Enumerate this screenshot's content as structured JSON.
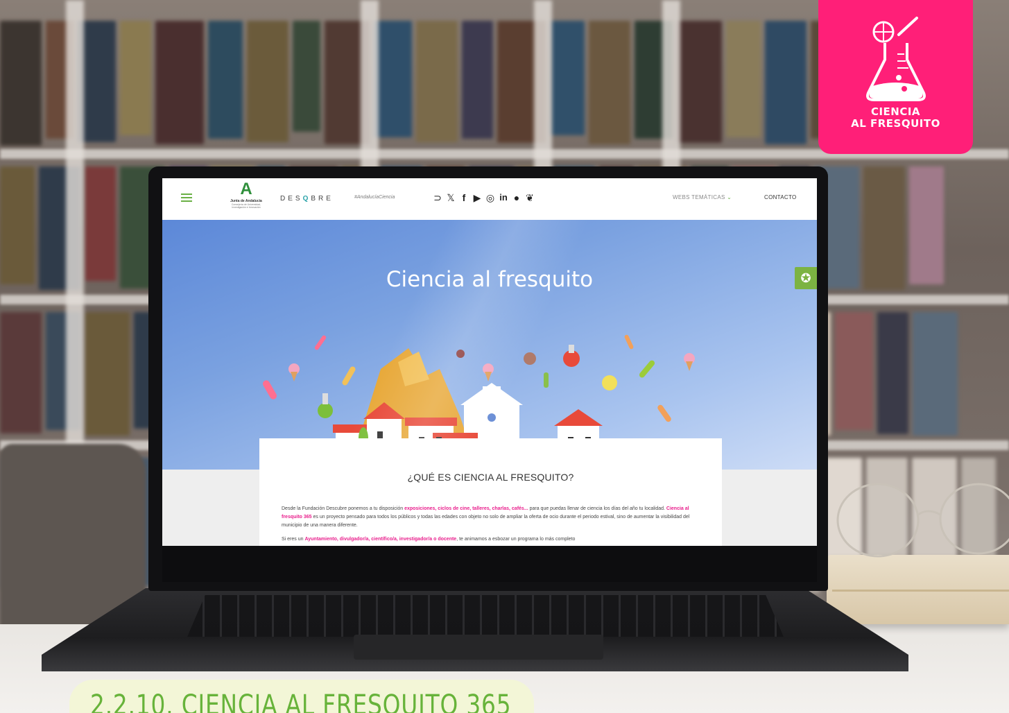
{
  "photo": {
    "description": ""
  },
  "badge": {
    "line1": "CIENCIA",
    "line2": "AL FRESQUITO",
    "color": "#ff1f78"
  },
  "website": {
    "nav": {
      "menu_icon": "hamburger-icon",
      "logo_main": "Junta de Andalucía",
      "logo_sub_1": "Consejería de Universidad,",
      "logo_sub_2": "Investigación e Innovación",
      "brand": "DESQBRE",
      "hashtag": "#AndalucíaCiencia",
      "social_icons": [
        "rss-icon",
        "x-icon",
        "facebook-icon",
        "youtube-icon",
        "instagram-icon",
        "linkedin-icon",
        "spotify-icon",
        "bluesky-icon"
      ],
      "webs_tematicas": "WEBS TEMÁTICAS",
      "contacto": "CONTACTO"
    },
    "hero": {
      "title": "Ciencia al fresquito",
      "accessibility_icon": "accessibility-icon"
    },
    "card": {
      "title": "¿QUÉ ES CIENCIA AL FRESQUITO?",
      "p1_a": "Desde la Fundación Descubre ponemos a tu disposición ",
      "p1_b": "exposiciones, ciclos de cine, talleres, charlas, cafés...",
      "p1_c": " para que puedas llenar de ciencia los días del año tu localidad. ",
      "p1_d": "Ciencia al fresquito 365",
      "p1_e": " es un proyecto pensado para todos los públicos y todas las edades con objeto no solo de ampliar la oferta de ocio durante el periodo estival, sino de aumentar la visibilidad del municipio de una manera diferente.",
      "p2_a": "Si eres un ",
      "p2_b": "Ayuntamiento, divulgador/a, científico/a, investigador/a o docente",
      "p2_c": ", te animamos a esbozar un programa lo más completo"
    },
    "colors": {
      "accent_green": "#6ab045",
      "highlight_pink": "#e91e8c"
    }
  },
  "section_heading": "2.2.10. CIENCIA AL FRESQUITO 365"
}
